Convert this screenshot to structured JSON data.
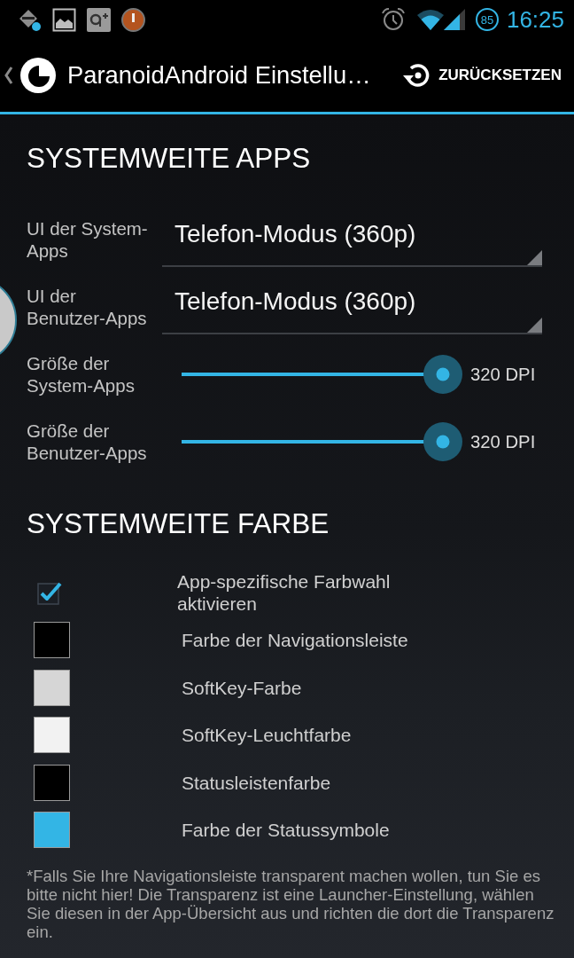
{
  "status_bar": {
    "battery_level": "85",
    "time": "16:25"
  },
  "action_bar": {
    "title": "ParanoidAndroid Einstellu…",
    "reset_button": "ZURÜCKSETZEN"
  },
  "sections": [
    {
      "heading": "SYSTEMWEITE APPS",
      "settings": [
        {
          "kind": "spinner",
          "label": "UI der System-\nApps",
          "value": "Telefon-Modus (360p)"
        },
        {
          "kind": "spinner",
          "label": "UI der\nBenutzer-Apps",
          "value": "Telefon-Modus (360p)"
        },
        {
          "kind": "slider",
          "label": "Größe der\nSystem-Apps",
          "level": 1,
          "reading": "320 DPI"
        },
        {
          "kind": "slider",
          "label": "Größe der\nBenutzer-Apps",
          "level": 1,
          "reading": "320 DPI"
        }
      ]
    },
    {
      "heading": "SYSTEMWEITE FARBE",
      "settings": [
        {
          "kind": "checkbox",
          "label": "App-spezifische Farbwahl\naktivieren",
          "checked": true
        },
        {
          "kind": "color",
          "label": "Farbe der Navigationsleiste",
          "color": "#000000"
        },
        {
          "kind": "color",
          "label": "SoftKey-Farbe",
          "color": "#d6d6d6"
        },
        {
          "kind": "color",
          "label": "SoftKey-Leuchtfarbe",
          "color": "#f2f2f2"
        },
        {
          "kind": "color",
          "label": "Statusleistenfarbe",
          "color": "#000000"
        },
        {
          "kind": "color",
          "label": "Farbe der Statussymbole",
          "color": "#33b5e5"
        }
      ]
    }
  ],
  "footnote": "*Falls Sie Ihre Navigationsleiste transparent machen wollen, tun Sie es\nbitte nicht hier! Die Transparenz ist eine Launcher-Einstellung, wählen\nSie diesen in der App-Übersicht aus und richten die dort die Transparenz\nein."
}
